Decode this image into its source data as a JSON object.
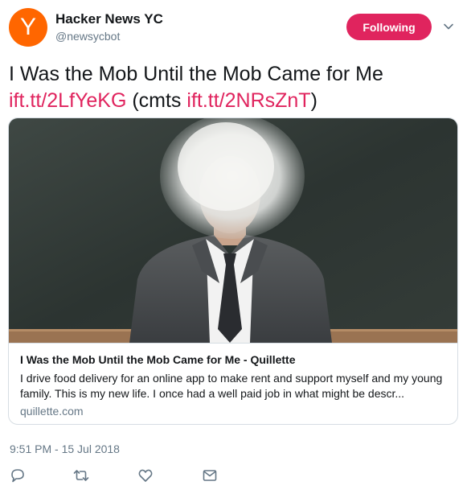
{
  "account": {
    "avatar_letter": "Y",
    "avatar_color": "#ff6600",
    "display_name": "Hacker News YC",
    "handle": "@newsycbot",
    "follow_label": "Following",
    "follow_color": "#e0245e"
  },
  "tweet": {
    "text": "I Was the Mob Until the Mob Came for Me",
    "link1": "ift.tt/2LfYeKG",
    "cmts_open": " (cmts ",
    "link2": "ift.tt/2NRsZnT",
    "cmts_close": ")",
    "link_color": "#e0245e",
    "timestamp": "9:51 PM - 15 Jul 2018"
  },
  "card": {
    "title": "I Was the Mob Until the Mob Came for Me - Quillette",
    "description": "I drive food delivery for an online app to make rent and support myself and my young family. This is my new life. I once had a well paid job in what might be descr...",
    "domain": "quillette.com"
  },
  "actions": {
    "reply_icon": "reply-icon",
    "retweet_icon": "retweet-icon",
    "like_icon": "like-icon",
    "message_icon": "message-icon"
  }
}
